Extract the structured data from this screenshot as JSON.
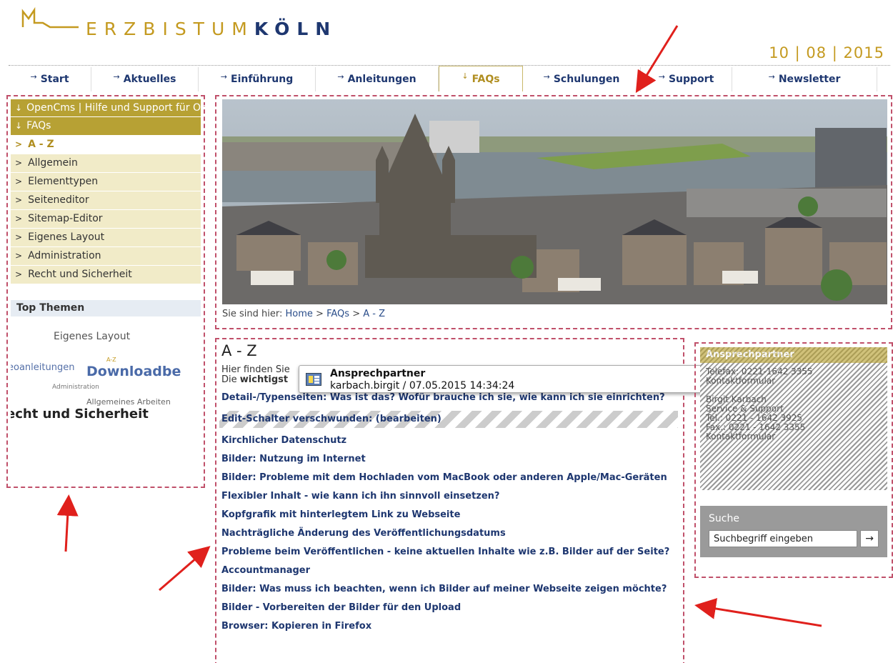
{
  "header": {
    "logo_prefix": "ERZBISTUM",
    "logo_city": "KÖLN",
    "date": "10 | 08 | 2015"
  },
  "nav": [
    {
      "label": "Start",
      "arrow": "→"
    },
    {
      "label": "Aktuelles",
      "arrow": "→"
    },
    {
      "label": "Einführung",
      "arrow": "→"
    },
    {
      "label": "Anleitungen",
      "arrow": "→"
    },
    {
      "label": "FAQs",
      "arrow": "↓",
      "active": true
    },
    {
      "label": "Schulungen",
      "arrow": "→"
    },
    {
      "label": "Support",
      "arrow": "→"
    },
    {
      "label": "Newsletter",
      "arrow": "→"
    }
  ],
  "left_nav": {
    "heading_marker": "↓",
    "head1": "OpenCms | Hilfe und Support für Online-Redakteure im Erzbistum Köln",
    "head2": "FAQs",
    "item_marker": ">",
    "current": "A - Z",
    "items": [
      "Allgemein",
      "Elementtypen",
      "Seiteneditor",
      "Sitemap-Editor",
      "Eigenes Layout",
      "Administration",
      "Recht und Sicherheit"
    ]
  },
  "top_themen": {
    "title": "Top Themen",
    "cloud": [
      "Eigenes Layout",
      "eoanleitungen",
      "A-Z",
      "Downloadbe",
      "Administration",
      "Allgemeines Arbeiten",
      "echt und Sicherheit"
    ]
  },
  "breadcrumb": {
    "prefix": "Sie sind hier:",
    "home": "Home",
    "sep": ">",
    "section": "FAQs",
    "page": "A - Z"
  },
  "content": {
    "title": "A - Z",
    "intro1": "Hier finden Sie",
    "intro2_prefix": "Die",
    "intro2_bold": "wichtigst",
    "faqs": [
      "Detail-/Typenseiten: Was ist das? Wofür brauche ich sie, wie kann ich sie einrichten?",
      "Edit-Schalter verschwunden: (bearbeiten)",
      "Kirchlicher Datenschutz",
      "Bilder: Nutzung im Internet",
      "Bilder: Probleme mit dem Hochladen vom MacBook oder anderen Apple/Mac-Geräten",
      "Flexibler Inhalt - wie kann ich ihn sinnvoll einsetzen?",
      "Kopfgrafik mit hinterlegtem Link zu Webseite",
      "Nachträgliche Änderung des Veröffentlichungsdatums",
      "Probleme beim Veröffentlichen - keine aktuellen Inhalte wie z.B. Bilder auf der Seite?",
      "Accountmanager",
      "Bilder: Was muss ich beachten, wenn ich Bilder auf meiner Webseite zeigen möchte?",
      "Bilder - Vorbereiten der Bilder für den Upload",
      "Browser: Kopieren in Firefox"
    ]
  },
  "popup": {
    "title": "Ansprechpartner",
    "subtitle": "karbach.birgit / 07.05.2015 14:34:24",
    "icon": "element-icon",
    "menu_icon": "grid-menu-icon"
  },
  "contact": {
    "title": "Ansprechpartner",
    "lines": [
      "Telefax: 0221-1642 3355",
      "Kontaktformular",
      "",
      "Birgit Karbach",
      "Service & Support",
      "Tel.: 0221 - 1642 3925",
      "Fax.: 0221 - 1642 3355",
      "Kontaktformular"
    ]
  },
  "search": {
    "title": "Suche",
    "value": "Suchbegriff eingeben",
    "button": "→"
  },
  "colors": {
    "gold": "#b7a134",
    "navy": "#1e3770",
    "dash": "#c0506a",
    "arrow": "#e0201c"
  }
}
